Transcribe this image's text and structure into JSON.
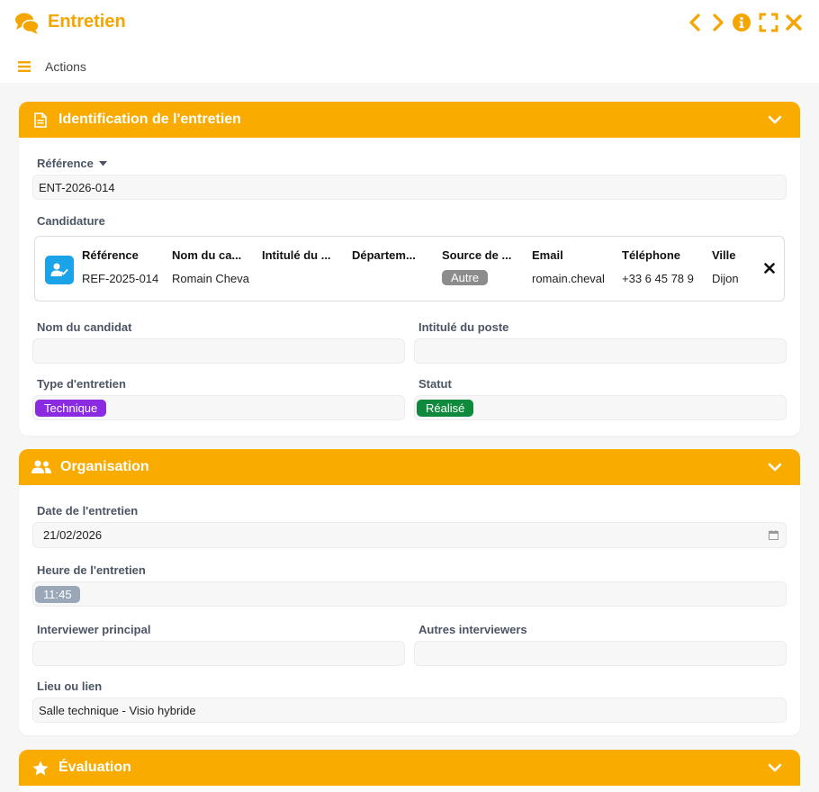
{
  "window": {
    "title": "Entretien",
    "actions_label": "Actions"
  },
  "colors": {
    "accent": "#f9ab00",
    "title_accent": "#f5a500",
    "type_badge": "#8a2be2",
    "status_badge": "#0f8a3c",
    "source_badge": "#8c8c8c",
    "time_badge": "#9aa7b8",
    "avatar": "#1aa3e8"
  },
  "sections": {
    "identification": {
      "title": "Identification de l'entretien",
      "reference_label": "Référence",
      "reference_value": "ENT-2026-014",
      "candidature_label": "Candidature",
      "candidature": {
        "headers": [
          "Référence",
          "Nom du ca...",
          "Intitulé du ...",
          "Départem...",
          "Source de ...",
          "Email",
          "Téléphone",
          "Ville"
        ],
        "values": [
          "REF-2025-014",
          "Romain Cheva",
          "",
          "",
          "",
          "romain.cheval",
          "+33 6 45 78 9",
          "Dijon"
        ],
        "source_badge": "Autre"
      },
      "candidate_name_label": "Nom du candidat",
      "candidate_name_value": "",
      "job_title_label": "Intitulé du poste",
      "job_title_value": "",
      "type_label": "Type d'entretien",
      "type_value": "Technique",
      "status_label": "Statut",
      "status_value": "Réalisé"
    },
    "organisation": {
      "title": "Organisation",
      "date_label": "Date de l'entretien",
      "date_value": "21/02/2026",
      "time_label": "Heure de l'entretien",
      "time_value": "11:45",
      "main_interviewer_label": "Interviewer principal",
      "main_interviewer_value": "",
      "other_interviewers_label": "Autres interviewers",
      "other_interviewers_value": "",
      "place_label": "Lieu ou lien",
      "place_value": "Salle technique - Visio hybride"
    },
    "evaluation": {
      "title": "Évaluation"
    }
  },
  "icons": {
    "title": "comments-icon",
    "prev": "chevron-left-icon",
    "next": "chevron-right-icon",
    "info": "info-icon",
    "fullscreen": "expand-icon",
    "close": "close-icon",
    "menu": "hamburger-icon",
    "identification": "document-icon",
    "organisation": "users-icon",
    "evaluation": "star-icon",
    "collapse": "chevron-down-icon",
    "avatar": "user-check-icon",
    "remove": "close-icon",
    "calendar": "calendar-icon"
  }
}
